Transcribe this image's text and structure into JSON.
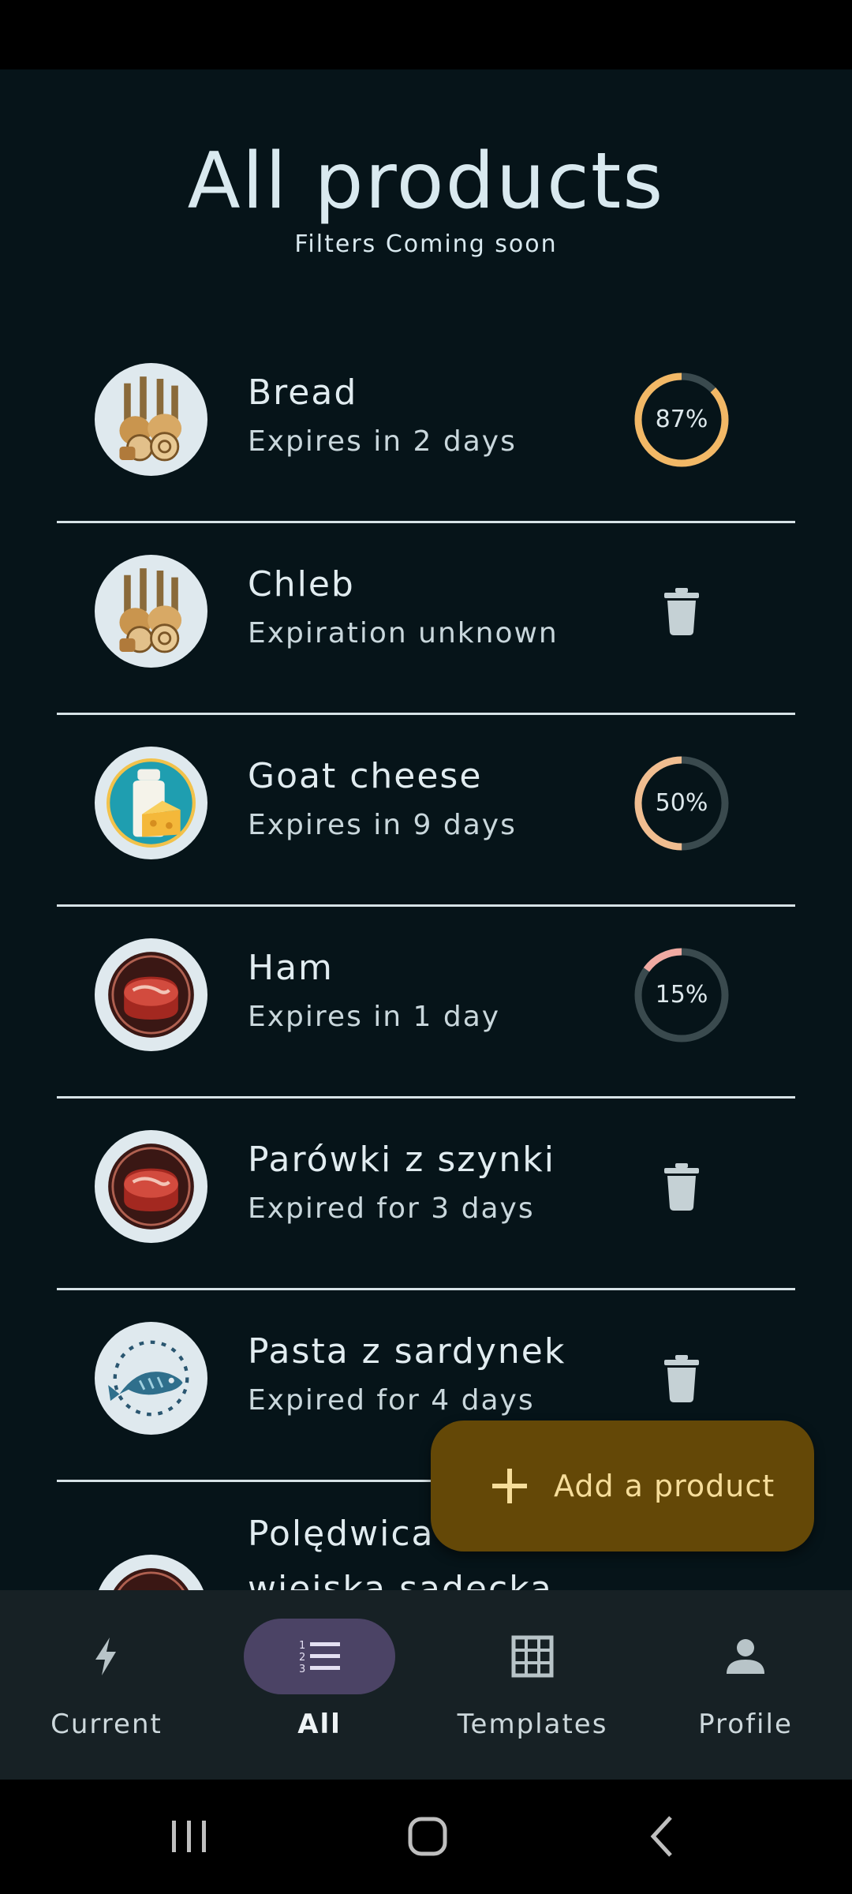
{
  "header": {
    "title": "All products",
    "subtitle": "Filters Coming soon"
  },
  "products": [
    {
      "name": "Bread",
      "status": "Expires in 2 days",
      "icon": "bread-icon",
      "freshness_percent": 87,
      "percent_label": "87%",
      "ring_color": "#f2b866"
    },
    {
      "name": "Chleb",
      "status": "Expiration unknown",
      "icon": "bread-icon",
      "action": "delete"
    },
    {
      "name": "Goat cheese",
      "status": "Expires in 9 days",
      "icon": "milk-cheese-icon",
      "freshness_percent": 50,
      "percent_label": "50%",
      "ring_color": "#f0bd90"
    },
    {
      "name": "Ham",
      "status": "Expires in 1 day",
      "icon": "meat-icon",
      "freshness_percent": 15,
      "percent_label": "15%",
      "ring_color": "#f0aaa2"
    },
    {
      "name": "Parówki z szynki",
      "status": "Expired for 3 days",
      "icon": "meat-icon",
      "action": "delete"
    },
    {
      "name": "Pasta z sardynek",
      "status": "Expired for 4 days",
      "icon": "fish-icon",
      "action": "delete"
    },
    {
      "name": "Polędwica",
      "name_line2": "wiejska sądecka",
      "icon": "meat-icon",
      "action": "delete"
    }
  ],
  "fab": {
    "label": "Add a product",
    "icon": "plus-icon"
  },
  "nav": {
    "active": "All",
    "items": [
      {
        "label": "Current",
        "icon": "bolt-icon"
      },
      {
        "label": "All",
        "icon": "numbered-list-icon"
      },
      {
        "label": "Templates",
        "icon": "grid-icon"
      },
      {
        "label": "Profile",
        "icon": "person-icon"
      }
    ]
  },
  "colors": {
    "background": "#061419",
    "fab": "#644807",
    "nav_background": "#172125",
    "nav_active_pill": "#4b4365",
    "ring_track": "#3a4a4e"
  }
}
